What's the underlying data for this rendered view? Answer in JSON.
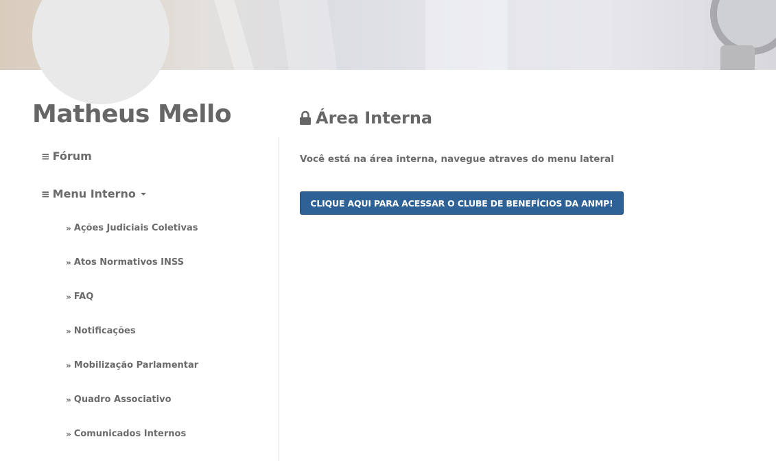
{
  "header": {
    "user_name": "Matheus Mello"
  },
  "sidebar": {
    "forum_label": "Fórum",
    "menu_label": "Menu Interno",
    "items": [
      {
        "label": "Ações Judiciais Coletivas"
      },
      {
        "label": "Atos Normativos INSS"
      },
      {
        "label": "FAQ"
      },
      {
        "label": "Notificações"
      },
      {
        "label": "Mobilização Parlamentar"
      },
      {
        "label": "Quadro Associativo"
      },
      {
        "label": "Comunicados Internos"
      }
    ],
    "icons": {
      "menu": "bars-icon",
      "dropdown": "caret-down-icon",
      "sub_item": "double-chevron-right-icon"
    }
  },
  "main": {
    "title": "Área Interna",
    "title_icon": "lock-icon",
    "intro": "Você está na área interna, navegue atraves do menu lateral",
    "cta_label": "CLIQUE AQUI PARA ACESSAR O CLUBE DE BENEFÍCIOS DA ANMP!"
  },
  "colors": {
    "text": "#6b6b6b",
    "button": "#2e6195",
    "avatar_placeholder": "#e9e9e9",
    "divider": "#dedede"
  }
}
